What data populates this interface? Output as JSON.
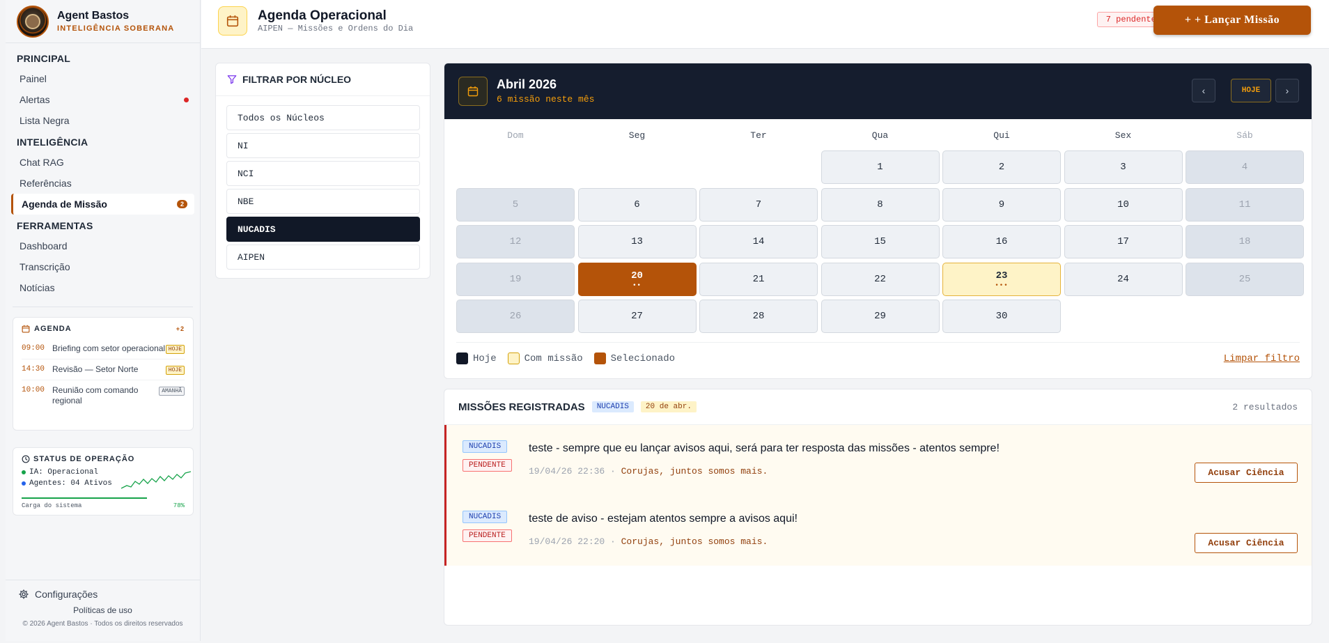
{
  "brand": {
    "name": "Agent Bastos",
    "subtitle": "INTELIGÊNCIA SOBERANA"
  },
  "nav": {
    "sections": [
      {
        "title": "PRINCIPAL",
        "items": [
          {
            "label": "Painel"
          },
          {
            "label": "Alertas",
            "indicator": "red-dot"
          },
          {
            "label": "Lista Negra"
          }
        ]
      },
      {
        "title": "INTELIGÊNCIA",
        "items": [
          {
            "label": "Chat RAG"
          },
          {
            "label": "Referências"
          },
          {
            "label": "Agenda de Missão",
            "active": true,
            "badge": "2"
          }
        ]
      },
      {
        "title": "FERRAMENTAS",
        "items": [
          {
            "label": "Dashboard"
          },
          {
            "label": "Transcrição"
          },
          {
            "label": "Notícias"
          }
        ]
      }
    ]
  },
  "agenda_widget": {
    "title": "AGENDA",
    "more": "+2",
    "items": [
      {
        "time": "09:00",
        "title": "Briefing com setor operacional",
        "tag": "HOJE"
      },
      {
        "time": "14:30",
        "title": "Revisão — Setor Norte",
        "tag": "HOJE"
      },
      {
        "time": "10:00",
        "title": "Reunião com comando regional",
        "tag": "AMANHÃ"
      }
    ]
  },
  "status_widget": {
    "title": "STATUS DE OPERAÇÃO",
    "ia": "IA: Operacional",
    "agents": "Agentes: 04 Ativos",
    "load_label": "Carga do sistema",
    "load_value": "78%",
    "colors": {
      "ok": "#16a34a",
      "info": "#2563eb"
    }
  },
  "footer": {
    "settings": "Configurações",
    "policies": "Políticas de uso",
    "copyright": "© 2026 Agent Bastos · Todos os direitos reservados"
  },
  "header": {
    "title": "Agenda Operacional",
    "subtitle": "AIPEN — Missões e Ordens do Dia",
    "pending": "7 pendentes",
    "launch_label": "+ + Lançar Missão"
  },
  "filter": {
    "title": "FILTRAR POR NÚCLEO",
    "options": [
      "Todos os Núcleos",
      "NI",
      "NCI",
      "NBE",
      "NUCADIS",
      "AIPEN"
    ],
    "selected": "NUCADIS"
  },
  "calendar": {
    "month": "Abril 2026",
    "count": "6 missão neste mês",
    "today_btn": "HOJE",
    "prev_icon": "chevron-left-icon",
    "next_icon": "chevron-right-icon",
    "weekdays": [
      "Dom",
      "Seg",
      "Ter",
      "Qua",
      "Qui",
      "Sex",
      "Sáb"
    ],
    "first_weekday_index": 3,
    "days_in_month": 30,
    "selected_day": 20,
    "mission_days": [
      20,
      23
    ],
    "mission_dots": {
      "20": "••",
      "23": "•••"
    },
    "legend": {
      "today": "Hoje",
      "with_mission": "Com missão",
      "selected": "Selecionado"
    },
    "clear_filter": "Limpar filtro",
    "colors": {
      "today": "#111827",
      "with_mission": "#fef3c7",
      "selected": "#b45309"
    }
  },
  "missions": {
    "title": "MISSÕES REGISTRADAS",
    "filter_chip": "NUCADIS",
    "date_chip": "20 de abr.",
    "count": "2 resultados",
    "items": [
      {
        "nucleo": "NUCADIS",
        "status": "PENDENTE",
        "text": "teste - sempre que eu lançar avisos aqui, será para ter resposta das missões - atentos sempre!",
        "datetime": "19/04/26 22:36",
        "signature": "Corujas, juntos somos mais.",
        "action": "Acusar Ciência"
      },
      {
        "nucleo": "NUCADIS",
        "status": "PENDENTE",
        "text": "teste de aviso - estejam atentos sempre a avisos aqui!",
        "datetime": "19/04/26 22:20",
        "signature": "Corujas, juntos somos mais.",
        "action": "Acusar Ciência"
      }
    ]
  }
}
